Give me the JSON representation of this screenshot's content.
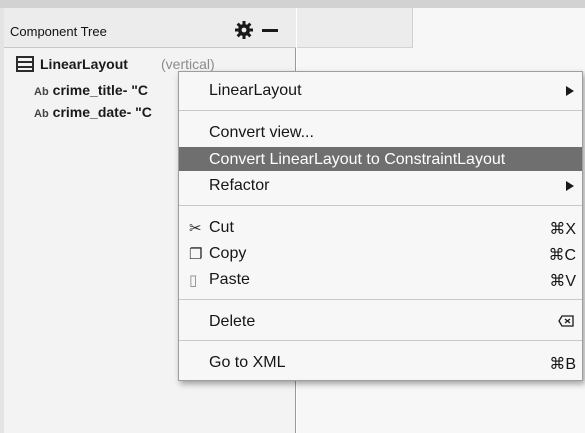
{
  "panel": {
    "title": "Component Tree"
  },
  "tree": {
    "root_label": "LinearLayout",
    "root_sub": "(vertical)",
    "children": [
      {
        "icon_text": "Ab",
        "label": "crime_title- \"C"
      },
      {
        "icon_text": "Ab",
        "label": "crime_date- \"C"
      }
    ]
  },
  "menu": {
    "items": [
      {
        "label": "LinearLayout",
        "submenu": true
      },
      {
        "label": "Convert view..."
      },
      {
        "label": "Convert LinearLayout to ConstraintLayout",
        "highlighted": true
      },
      {
        "label": "Refactor",
        "submenu": true
      },
      {
        "label": "Cut",
        "shortcut": "⌘X",
        "icon": "cut-icon",
        "glyph": "✂"
      },
      {
        "label": "Copy",
        "shortcut": "⌘C",
        "icon": "copy-icon",
        "glyph": "❐"
      },
      {
        "label": "Paste",
        "shortcut": "⌘V",
        "icon": "paste-icon",
        "glyph": "▯"
      },
      {
        "label": "Delete",
        "icon_right": "delete-key-icon"
      },
      {
        "label": "Go to XML",
        "shortcut": "⌘B"
      }
    ]
  },
  "colors": {
    "highlight": "#6f6f6f",
    "menu_bg": "#f7f7f7",
    "panel_bg": "#f3f3f3"
  }
}
